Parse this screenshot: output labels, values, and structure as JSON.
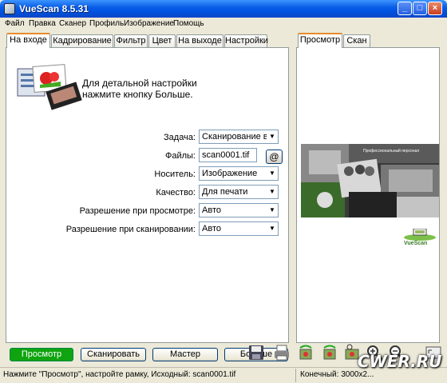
{
  "window": {
    "title": "VueScan 8.5.31"
  },
  "menu": [
    "Файл",
    "Правка",
    "Сканер",
    "Профиль",
    "Изображение",
    "Помощь"
  ],
  "left_tabs": [
    "На входе",
    "Кадрирование",
    "Фильтр",
    "Цвет",
    "На выходе",
    "Настройки"
  ],
  "right_tabs": [
    "Просмотр",
    "Скан"
  ],
  "hint": {
    "line1": "Для детальной настройки",
    "line2": "нажмите кнопку Больше."
  },
  "form": {
    "task_label": "Задача:",
    "task_value": "Сканирование в ф",
    "files_label": "Файлы:",
    "files_value": "scan0001.tif",
    "files_button": "@",
    "media_label": "Носитель:",
    "media_value": "Изображение",
    "quality_label": "Качество:",
    "quality_value": "Для печати",
    "preview_res_label": "Разрешение при просмотре:",
    "preview_res_value": "Авто",
    "scan_res_label": "Разрешение при сканировании:",
    "scan_res_value": "Авто"
  },
  "preview": {
    "banner_text": "Профессиональный персонал",
    "logo_text": "VueScan"
  },
  "buttons": {
    "preview": "Просмотр",
    "scan": "Сканировать",
    "wizard": "Мастер",
    "more": "Больше"
  },
  "status": {
    "left": "Нажмите \"Просмотр\", настройте рамку, Исходный: scan0001.tif",
    "right": "Конечный: 3000x2..."
  },
  "watermark": "CWER.RU",
  "colors": {
    "accent_tab": "#e68b2c",
    "preview_button": "#0fa40f",
    "title_blue": "#0054e3"
  }
}
